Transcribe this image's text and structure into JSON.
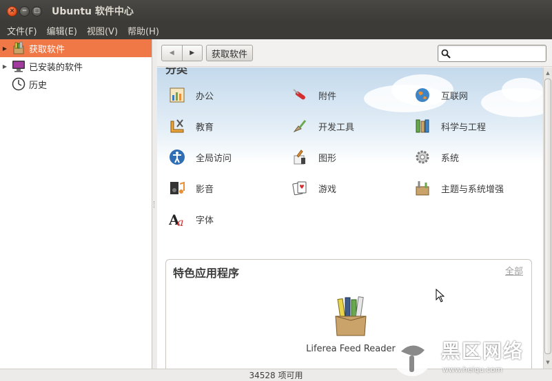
{
  "window": {
    "title": "Ubuntu 软件中心",
    "buttons": {
      "close": "×",
      "minimize": "−",
      "maximize": "□"
    }
  },
  "menubar": [
    "文件(F)",
    "编辑(E)",
    "视图(V)",
    "帮助(H)"
  ],
  "sidebar": {
    "items": [
      {
        "label": "获取软件",
        "icon": "get-software-icon",
        "expander": "▶",
        "selected": true
      },
      {
        "label": "已安装的软件",
        "icon": "installed-software-icon",
        "expander": "▶",
        "selected": false
      },
      {
        "label": "历史",
        "icon": "history-clock-icon",
        "expander": "",
        "selected": false
      }
    ]
  },
  "toolbar": {
    "back_glyph": "◀",
    "forward_glyph": "▶",
    "breadcrumb": "获取软件",
    "search_placeholder": "",
    "search_value": ""
  },
  "main": {
    "section_title": "分类",
    "categories": [
      {
        "label": "办公",
        "icon": "office-icon"
      },
      {
        "label": "附件",
        "icon": "accessories-icon"
      },
      {
        "label": "互联网",
        "icon": "internet-icon"
      },
      {
        "label": "教育",
        "icon": "education-icon"
      },
      {
        "label": "开发工具",
        "icon": "developer-tools-icon"
      },
      {
        "label": "科学与工程",
        "icon": "science-icon"
      },
      {
        "label": "全局访问",
        "icon": "accessibility-icon"
      },
      {
        "label": "图形",
        "icon": "graphics-icon"
      },
      {
        "label": "系统",
        "icon": "system-icon"
      },
      {
        "label": "影音",
        "icon": "multimedia-icon"
      },
      {
        "label": "游戏",
        "icon": "games-icon"
      },
      {
        "label": "主题与系统增强",
        "icon": "themes-tweaks-icon"
      },
      {
        "label": "字体",
        "icon": "fonts-icon"
      }
    ],
    "featured": {
      "title": "特色应用程序",
      "all_link": "全部",
      "app": {
        "label": "Liferea Feed Reader",
        "icon": "liferea-box-icon"
      }
    }
  },
  "statusbar": {
    "text": "34528 项可用"
  },
  "watermark": {
    "text": "黑区网络",
    "url": "www.heiqu.com"
  },
  "colors": {
    "selected": "#f07746",
    "titlebar": "#3c3b37",
    "window_bg": "#f2f1f0"
  }
}
